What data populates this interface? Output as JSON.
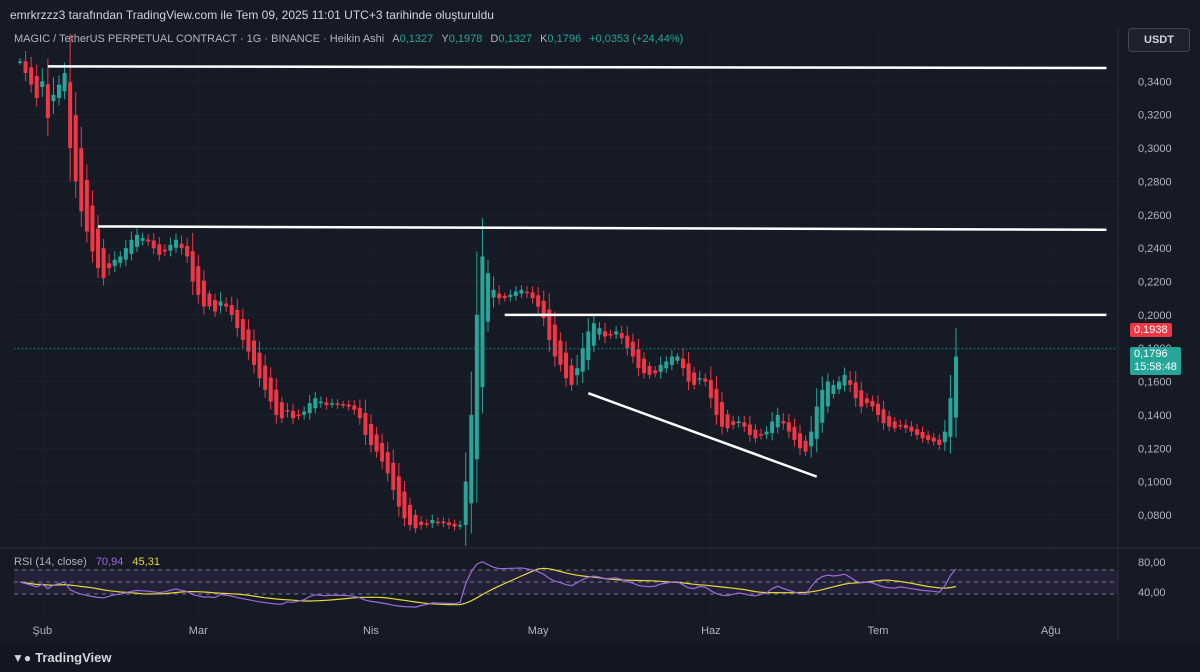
{
  "attribution": "emrkrzzz3 tarafından TradingView.com ile Tem 09, 2025 11:01 UTC+3 tarihinde oluşturuldu",
  "legend": {
    "symbol": "MAGIC / TetherUS PERPETUAL CONTRACT · 1G · BINANCE · Heikin Ashi",
    "open_label": "A",
    "open": "0,1327",
    "high_label": "Y",
    "high": "0,1978",
    "low_label": "D",
    "low": "0,1327",
    "close_label": "K",
    "close": "0,1796",
    "change": "+0,0353 (+24,44%)"
  },
  "currency": "USDT",
  "price_tags": {
    "high_tag": "0,1938",
    "last_price": "0,1796",
    "countdown": "15:58:48"
  },
  "rsi_legend": {
    "label": "RSI (14, close)",
    "rsi": "70,94",
    "ma": "45,31"
  },
  "footer": {
    "logo_text": "TradingView"
  },
  "colors": {
    "bg": "#161a25",
    "up": "#26a69a",
    "down": "#f23645",
    "rsi": "#9c6ade",
    "rsi_ma": "#e6d83c",
    "line": "#ffffff"
  },
  "chart_data": {
    "type": "candlestick",
    "price_axis": {
      "ylim": [
        0.062,
        0.36
      ],
      "ticks": [
        0.34,
        0.32,
        0.3,
        0.28,
        0.26,
        0.24,
        0.22,
        0.2,
        0.18,
        0.16,
        0.14,
        0.12,
        0.1,
        0.08
      ],
      "tick_labels": [
        "0,3400",
        "0,3200",
        "0,3000",
        "0,2800",
        "0,2600",
        "0,2400",
        "0,2200",
        "0,2000",
        "0,1800",
        "0,1600",
        "0,1400",
        "0,1200",
        "0,1000",
        "0,0800"
      ]
    },
    "x_axis": {
      "labels": [
        "Şub",
        "Mar",
        "Nis",
        "May",
        "Haz",
        "Tem",
        "Ağu"
      ],
      "label_day_index": [
        4,
        32,
        63,
        93,
        124,
        154,
        185
      ]
    },
    "price_series": [
      0.352,
      0.345,
      0.338,
      0.33,
      0.34,
      0.318,
      0.332,
      0.338,
      0.345,
      0.3,
      0.28,
      0.262,
      0.25,
      0.238,
      0.228,
      0.222,
      0.228,
      0.233,
      0.235,
      0.24,
      0.245,
      0.248,
      0.246,
      0.244,
      0.24,
      0.236,
      0.238,
      0.242,
      0.245,
      0.24,
      0.235,
      0.22,
      0.212,
      0.205,
      0.205,
      0.202,
      0.208,
      0.205,
      0.2,
      0.192,
      0.185,
      0.178,
      0.17,
      0.162,
      0.155,
      0.148,
      0.14,
      0.138,
      0.142,
      0.138,
      0.14,
      0.142,
      0.147,
      0.15,
      0.148,
      0.146,
      0.147,
      0.146,
      0.146,
      0.145,
      0.143,
      0.138,
      0.128,
      0.122,
      0.118,
      0.112,
      0.105,
      0.095,
      0.085,
      0.078,
      0.074,
      0.072,
      0.074,
      0.075,
      0.077,
      0.076,
      0.075,
      0.074,
      0.073,
      0.074,
      0.1,
      0.14,
      0.2,
      0.235,
      0.225,
      0.215,
      0.21,
      0.21,
      0.212,
      0.214,
      0.215,
      0.213,
      0.21,
      0.205,
      0.198,
      0.185,
      0.175,
      0.17,
      0.162,
      0.158,
      0.168,
      0.18,
      0.19,
      0.195,
      0.192,
      0.187,
      0.188,
      0.19,
      0.186,
      0.18,
      0.175,
      0.168,
      0.165,
      0.164,
      0.165,
      0.17,
      0.172,
      0.175,
      0.175,
      0.168,
      0.16,
      0.158,
      0.162,
      0.16,
      0.15,
      0.14,
      0.133,
      0.132,
      0.134,
      0.136,
      0.133,
      0.128,
      0.126,
      0.128,
      0.13,
      0.136,
      0.14,
      0.135,
      0.13,
      0.125,
      0.12,
      0.118,
      0.13,
      0.145,
      0.155,
      0.16,
      0.158,
      0.16,
      0.164,
      0.158,
      0.15,
      0.145,
      0.147,
      0.145,
      0.14,
      0.135,
      0.133,
      0.132,
      0.134,
      0.132,
      0.13,
      0.128,
      0.126,
      0.125,
      0.124,
      0.122,
      0.13,
      0.15,
      0.175
    ],
    "rsi": {
      "ylim": [
        0,
        100
      ],
      "bands": [
        70,
        50,
        30
      ],
      "labels": [
        "80,00",
        "40,00"
      ],
      "last": 70.94,
      "ma_last": 45.31
    },
    "drawings": [
      {
        "name": "resistance-line-top",
        "x1": 5,
        "y1": 0.349,
        "x2": 195,
        "y2": 0.348
      },
      {
        "name": "resistance-line-mid",
        "x1": 14,
        "y1": 0.253,
        "x2": 195,
        "y2": 0.251
      },
      {
        "name": "resistance-line-low",
        "x1": 87,
        "y1": 0.2,
        "x2": 195,
        "y2": 0.2
      },
      {
        "name": "descending-trendline",
        "x1": 102,
        "y1": 0.153,
        "x2": 143,
        "y2": 0.103
      }
    ]
  }
}
